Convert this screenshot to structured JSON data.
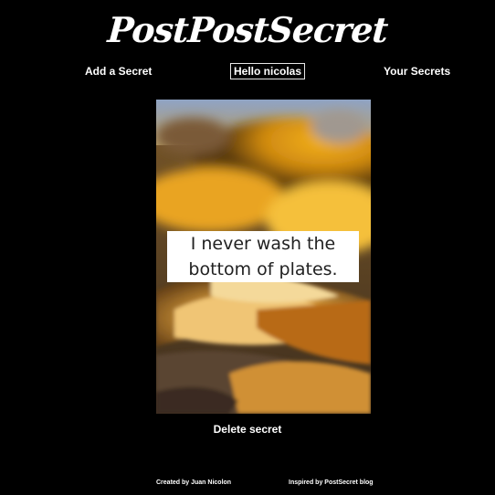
{
  "header": {
    "logo_text": "PostPostSecret"
  },
  "nav": {
    "add_secret": "Add a Secret",
    "hello_user": "Hello nicolas",
    "your_secrets": "Your Secrets"
  },
  "secret": {
    "text": "I never wash the bottom of plates.",
    "delete_label": "Delete secret"
  },
  "footer": {
    "created_by": "Created by Juan Nicolon",
    "inspired_by": "Inspired by PostSecret blog"
  }
}
